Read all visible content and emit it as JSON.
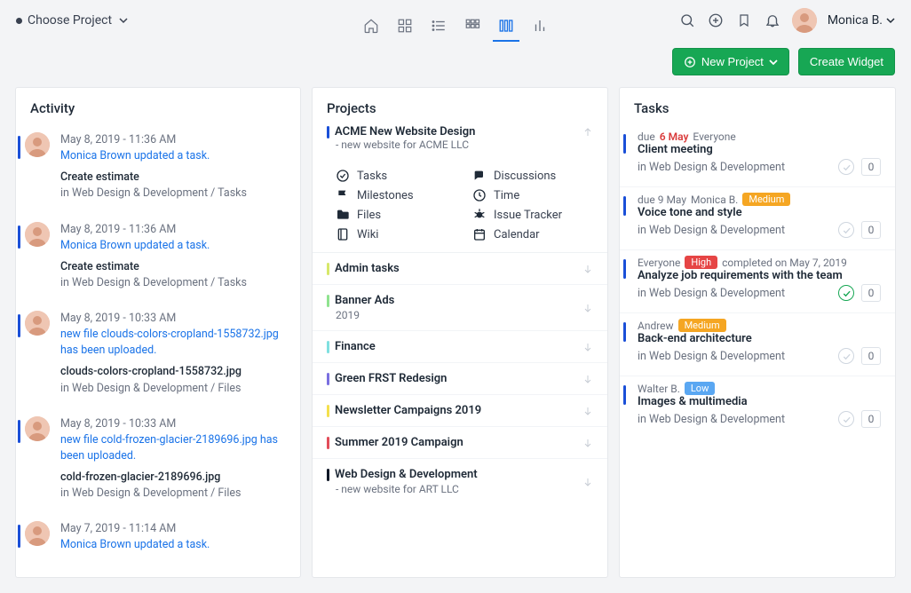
{
  "header": {
    "choose_project": "Choose Project",
    "user_name": "Monica B."
  },
  "actions": {
    "new_project": "New Project",
    "create_widget": "Create Widget"
  },
  "panels": {
    "activity_title": "Activity",
    "projects_title": "Projects",
    "tasks_title": "Tasks"
  },
  "activity": [
    {
      "time": "May 8, 2019 - 11:36 AM",
      "link": "Monica Brown updated a task.",
      "title": "Create estimate",
      "location": "in Web Design & Development / Tasks"
    },
    {
      "time": "May 8, 2019 - 11:36 AM",
      "link": "Monica Brown updated a task.",
      "title": "Create estimate",
      "location": "in Web Design & Development / Tasks"
    },
    {
      "time": "May 8, 2019 - 10:33 AM",
      "link": "new file clouds-colors-cropland-1558732.jpg has been uploaded.",
      "title": "clouds-colors-cropland-1558732.jpg",
      "location": "in Web Design & Development / Files"
    },
    {
      "time": "May 8, 2019 - 10:33 AM",
      "link": "new file cold-frozen-glacier-2189696.jpg has been uploaded.",
      "title": "cold-frozen-glacier-2189696.jpg",
      "location": "in Web Design & Development / Files"
    },
    {
      "time": "May 7, 2019 - 11:14 AM",
      "link": "Monica Brown updated a task.",
      "title": "",
      "location": ""
    }
  ],
  "projects": {
    "primary": {
      "title": "ACME New Website Design",
      "sub": "- new website for ACME LLC",
      "color": "#1a4fd8",
      "tools": [
        {
          "label": "Tasks",
          "icon": "check"
        },
        {
          "label": "Discussions",
          "icon": "chat"
        },
        {
          "label": "Milestones",
          "icon": "flag"
        },
        {
          "label": "Time",
          "icon": "clock"
        },
        {
          "label": "Files",
          "icon": "folder"
        },
        {
          "label": "Issue Tracker",
          "icon": "bug"
        },
        {
          "label": "Wiki",
          "icon": "notebook"
        },
        {
          "label": "Calendar",
          "icon": "calendar"
        }
      ]
    },
    "list": [
      {
        "label": "Admin tasks",
        "sub": "",
        "color": "#d7e86a"
      },
      {
        "label": "Banner Ads",
        "sub": "2019",
        "color": "#8fe38f"
      },
      {
        "label": "Finance",
        "sub": "",
        "color": "#7fe0e0"
      },
      {
        "label": "Green FRST Redesign",
        "sub": "",
        "color": "#7a6fe0"
      },
      {
        "label": "Newsletter Campaigns 2019",
        "sub": "",
        "color": "#f4e04d"
      },
      {
        "label": "Summer 2019 Campaign",
        "sub": "",
        "color": "#e24d5a"
      },
      {
        "label": "Web Design & Development",
        "sub": "- new website for ART LLC",
        "color": "#101826"
      }
    ]
  },
  "tasks": [
    {
      "meta_prefix": "due",
      "meta_red": "6 May",
      "meta_suffix": "Everyone",
      "badge": null,
      "completed": "",
      "title": "Client meeting",
      "location": "in Web Design & Development",
      "done": false,
      "count": "0"
    },
    {
      "meta_prefix": "due 9 May",
      "meta_red": "",
      "meta_suffix": "Monica B.",
      "badge": "Medium",
      "completed": "",
      "title": "Voice tone and style",
      "location": "in Web Design & Development",
      "done": false,
      "count": "0"
    },
    {
      "meta_prefix": "Everyone",
      "meta_red": "",
      "meta_suffix": "",
      "badge": "High",
      "completed": "completed on May 7, 2019",
      "title": "Analyze job requirements with the team",
      "location": "in Web Design & Development",
      "done": true,
      "count": "0"
    },
    {
      "meta_prefix": "Andrew",
      "meta_red": "",
      "meta_suffix": "",
      "badge": "Medium",
      "completed": "",
      "title": "Back-end architecture",
      "location": "in Web Design & Development",
      "done": false,
      "count": "0"
    },
    {
      "meta_prefix": "Walter B.",
      "meta_red": "",
      "meta_suffix": "",
      "badge": "Low",
      "completed": "",
      "title": "Images & multimedia",
      "location": "in Web Design & Development",
      "done": false,
      "count": "0"
    }
  ]
}
